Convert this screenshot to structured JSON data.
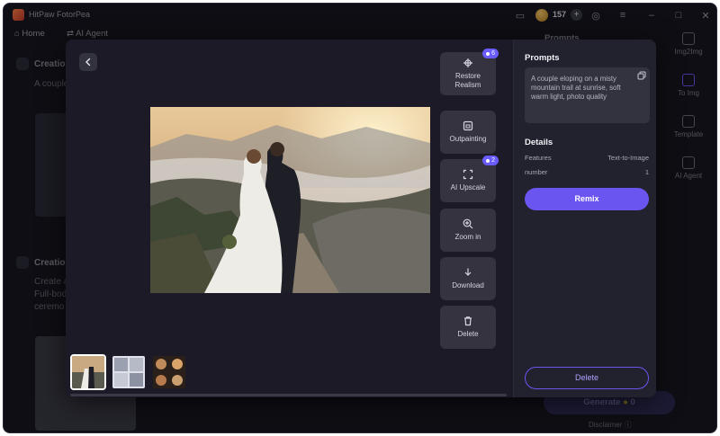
{
  "app": {
    "name": "HitPaw FotorPea",
    "coins": "157"
  },
  "nav": {
    "home": "Home",
    "ai_agent": "AI Agent"
  },
  "background": {
    "creation_1": "Creatio",
    "creation_1_text": "A couple",
    "creation_2": "Creatio",
    "creation_2_lines": [
      "Create a",
      "Full-bod",
      "ceremo"
    ],
    "prompts_label": "Prompts",
    "generate": "Generate",
    "generate_cost": "0",
    "disclaimer": "Disclaimer"
  },
  "rail": {
    "items": [
      "Img2Img",
      "To Img",
      "Template",
      "AI Agent"
    ]
  },
  "modal": {
    "tools": [
      {
        "label": "Restore\nRealism",
        "icon": "restore-icon",
        "badge": "6"
      },
      {
        "label": "Outpainting",
        "icon": "outpainting-icon",
        "badge": null
      },
      {
        "label": "AI Upscale",
        "icon": "upscale-icon",
        "badge": "2"
      },
      {
        "label": "Zoom in",
        "icon": "zoom-in-icon",
        "badge": null
      },
      {
        "label": "Download",
        "icon": "download-icon",
        "badge": null
      },
      {
        "label": "Delete",
        "icon": "trash-icon",
        "badge": null
      }
    ],
    "side": {
      "prompts_title": "Prompts",
      "prompt_text": "A couple eloping on a misty mountain trail at sunrise, soft warm light, photo quality",
      "details_title": "Details",
      "details": [
        {
          "key": "Features",
          "value": "Text-to-Image"
        },
        {
          "key": "number",
          "value": "1"
        }
      ],
      "remix_label": "Remix",
      "delete_label": "Delete"
    },
    "thumbnails": [
      "couple-photo",
      "grid-photo",
      "portrait-grid"
    ],
    "active_thumbnail": 0
  },
  "colors": {
    "accent": "#6b55f0",
    "badge": "#6a5cff"
  }
}
